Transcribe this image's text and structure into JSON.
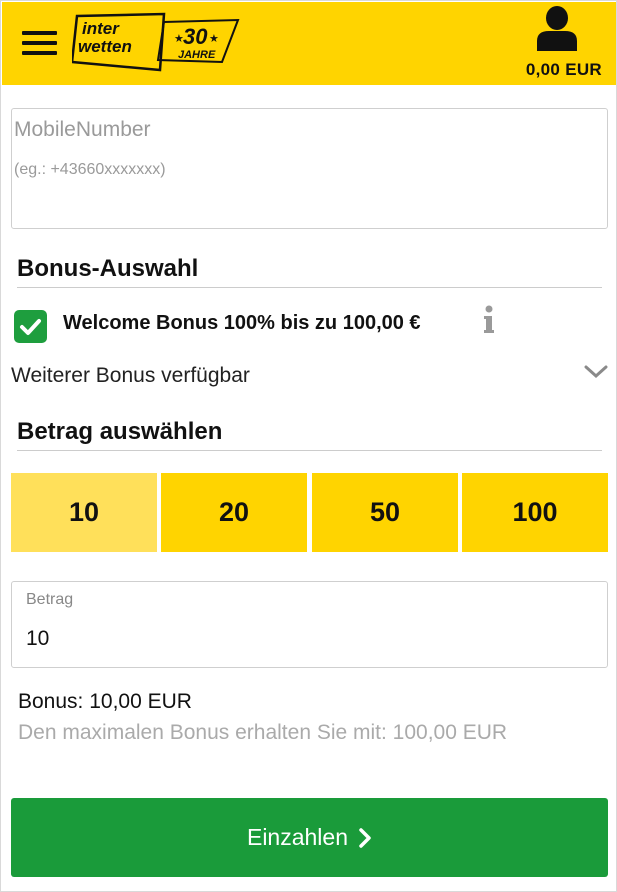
{
  "header": {
    "logo_line1": "inter",
    "logo_line2": "wetten",
    "logo_badge_number": "30",
    "logo_badge_text": "JAHRE",
    "balance": "0,00 EUR"
  },
  "mobile": {
    "placeholder": "MobileNumber",
    "hint": "(eg.: +43660xxxxxxx)"
  },
  "bonus_section": {
    "title": "Bonus-Auswahl",
    "checked": true,
    "bonus_label": "Welcome Bonus 100% bis zu 100,00 €",
    "more_label": "Weiterer Bonus verfügbar"
  },
  "amount_section": {
    "title": "Betrag auswählen",
    "options": [
      "10",
      "20",
      "50",
      "100"
    ],
    "selected": "10"
  },
  "betrag": {
    "label": "Betrag",
    "value": "10"
  },
  "summary": {
    "bonus": "Bonus: 10,00 EUR",
    "max_bonus": "Den maximalen Bonus erhalten Sie mit: 100,00 EUR"
  },
  "submit_label": "Einzahlen",
  "colors": {
    "brand_yellow": "#ffd400",
    "selected_yellow": "#ffe05a",
    "success_green": "#1a9b3a"
  }
}
